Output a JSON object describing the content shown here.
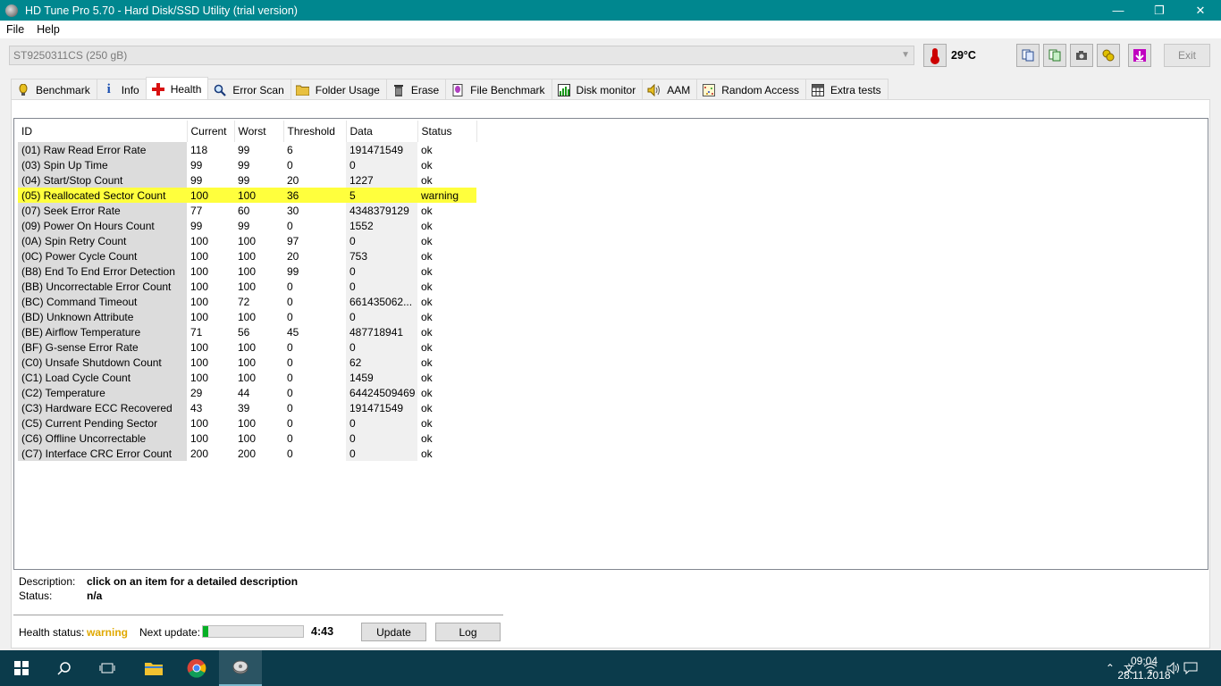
{
  "window": {
    "title": "HD Tune Pro 5.70 - Hard Disk/SSD Utility (trial version)",
    "minimize": "—",
    "maximize": "❐",
    "close": "✕"
  },
  "menu": {
    "file": "File",
    "help": "Help"
  },
  "toolbar": {
    "drive": "ST9250311CS (250 gB)",
    "temperature": "29°C",
    "exit_label": "Exit"
  },
  "tabs": [
    {
      "label": "Benchmark",
      "icon": "benchmark-icon"
    },
    {
      "label": "Info",
      "icon": "info-icon"
    },
    {
      "label": "Health",
      "icon": "health-icon"
    },
    {
      "label": "Error Scan",
      "icon": "error-scan-icon"
    },
    {
      "label": "Folder Usage",
      "icon": "folder-icon"
    },
    {
      "label": "Erase",
      "icon": "trash-icon"
    },
    {
      "label": "File Benchmark",
      "icon": "file-benchmark-icon"
    },
    {
      "label": "Disk monitor",
      "icon": "disk-monitor-icon"
    },
    {
      "label": "AAM",
      "icon": "speaker-icon"
    },
    {
      "label": "Random Access",
      "icon": "random-access-icon"
    },
    {
      "label": "Extra tests",
      "icon": "extra-tests-icon"
    }
  ],
  "health": {
    "columns": [
      "ID",
      "Current",
      "Worst",
      "Threshold",
      "Data",
      "Status"
    ],
    "rows": [
      [
        "(01) Raw Read Error Rate",
        "118",
        "99",
        "6",
        "191471549",
        "ok"
      ],
      [
        "(03) Spin Up Time",
        "99",
        "99",
        "0",
        "0",
        "ok"
      ],
      [
        "(04) Start/Stop Count",
        "99",
        "99",
        "20",
        "1227",
        "ok"
      ],
      [
        "(05) Reallocated Sector Count",
        "100",
        "100",
        "36",
        "5",
        "warning"
      ],
      [
        "(07) Seek Error Rate",
        "77",
        "60",
        "30",
        "4348379129",
        "ok"
      ],
      [
        "(09) Power On Hours Count",
        "99",
        "99",
        "0",
        "1552",
        "ok"
      ],
      [
        "(0A) Spin Retry Count",
        "100",
        "100",
        "97",
        "0",
        "ok"
      ],
      [
        "(0C) Power Cycle Count",
        "100",
        "100",
        "20",
        "753",
        "ok"
      ],
      [
        "(B8) End To End Error Detection",
        "100",
        "100",
        "99",
        "0",
        "ok"
      ],
      [
        "(BB) Uncorrectable Error Count",
        "100",
        "100",
        "0",
        "0",
        "ok"
      ],
      [
        "(BC) Command Timeout",
        "100",
        "72",
        "0",
        "661435062...",
        "ok"
      ],
      [
        "(BD) Unknown Attribute",
        "100",
        "100",
        "0",
        "0",
        "ok"
      ],
      [
        "(BE) Airflow Temperature",
        "71",
        "56",
        "45",
        "487718941",
        "ok"
      ],
      [
        "(BF) G-sense Error Rate",
        "100",
        "100",
        "0",
        "0",
        "ok"
      ],
      [
        "(C0) Unsafe Shutdown Count",
        "100",
        "100",
        "0",
        "62",
        "ok"
      ],
      [
        "(C1) Load Cycle Count",
        "100",
        "100",
        "0",
        "1459",
        "ok"
      ],
      [
        "(C2) Temperature",
        "29",
        "44",
        "0",
        "64424509469",
        "ok"
      ],
      [
        "(C3) Hardware ECC Recovered",
        "43",
        "39",
        "0",
        "191471549",
        "ok"
      ],
      [
        "(C5) Current Pending Sector",
        "100",
        "100",
        "0",
        "0",
        "ok"
      ],
      [
        "(C6) Offline Uncorrectable",
        "100",
        "100",
        "0",
        "0",
        "ok"
      ],
      [
        "(C7) Interface CRC Error Count",
        "200",
        "200",
        "0",
        "0",
        "ok"
      ]
    ],
    "description_label": "Description:",
    "description_value": "click on an item for a detailed description",
    "status_label": "Status:",
    "status_value": "n/a",
    "health_status_label": "Health status:",
    "health_status_value": "warning",
    "next_update_label": "Next update:",
    "next_update_progress": 0.05,
    "countdown": "4:43",
    "update_label": "Update",
    "log_label": "Log",
    "warning_color": "#ffff3d"
  },
  "taskbar": {
    "time": "09:04",
    "date": "28.11.2018",
    "lang": "文"
  }
}
